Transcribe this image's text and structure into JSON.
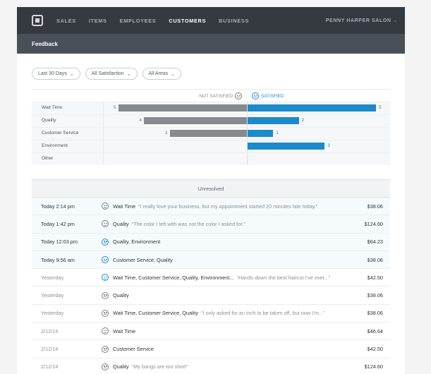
{
  "nav": {
    "items": [
      "SALES",
      "ITEMS",
      "EMPLOYEES",
      "CUSTOMERS",
      "BUSINESS"
    ],
    "active": "CUSTOMERS",
    "account": "PENNY HARPER SALON"
  },
  "subbar": {
    "title": "Feedback"
  },
  "filters": [
    {
      "label": "Last 30 Days"
    },
    {
      "label": "All Satisfaction"
    },
    {
      "label": "All Areas"
    }
  ],
  "chart_data": {
    "type": "bar",
    "header": {
      "negative": "NOT SATISFIED",
      "positive": "SATISFIED"
    },
    "categories": [
      "Wait Time",
      "Quality",
      "Customer Service",
      "Environment",
      "Other"
    ],
    "series": [
      {
        "name": "NOT SATISFIED",
        "values": [
          5,
          4,
          3,
          null,
          null
        ]
      },
      {
        "name": "SATISFIED",
        "values": [
          5,
          2,
          1,
          3,
          null
        ]
      }
    ],
    "colors": {
      "negative": "#86898e",
      "positive": "#1b8bcb"
    },
    "max": 5
  },
  "unresolved": {
    "label": "Unresolved"
  },
  "feedback": [
    {
      "date": "Today  2:14 pm",
      "categories": "Wait Time",
      "quote": "“I really love your business, but my appointment started 20 minutes late today.”",
      "amount": "$38.06",
      "satisfied": false,
      "unread": true
    },
    {
      "date": "Today  1:42 pm",
      "categories": "Quality",
      "quote": "“The color I left with was not the color I asked for.”",
      "amount": "$124.60",
      "satisfied": false,
      "unread": true
    },
    {
      "date": "Today  12:03 pm",
      "categories": "Quality, Environment",
      "quote": "",
      "amount": "$64.23",
      "satisfied": true,
      "unread": true
    },
    {
      "date": "Today  9:56 am",
      "categories": "Customer Service, Quality",
      "quote": "",
      "amount": "$38.06",
      "satisfied": true,
      "unread": true
    },
    {
      "date": "Yesterday",
      "categories": "Wait Time, Customer Service, Quality, Environment...",
      "quote": "“Hands down the best haircut I’ve ever...”",
      "amount": "$42.50",
      "satisfied": true,
      "unread": false
    },
    {
      "date": "Yesterday",
      "categories": "Quality",
      "quote": "",
      "amount": "$38.06",
      "satisfied": false,
      "unread": false
    },
    {
      "date": "Yesterday",
      "categories": "Wait Time, Customer Service, Quality",
      "quote": "“I only asked for an inch to be taken off, but now I’m...”",
      "amount": "$38.06",
      "satisfied": false,
      "unread": false
    },
    {
      "date": "2/12/14",
      "categories": "Wait Time",
      "quote": "",
      "amount": "$46.64",
      "satisfied": false,
      "unread": false
    },
    {
      "date": "2/12/14",
      "categories": "Customer Service",
      "quote": "",
      "amount": "$42.50",
      "satisfied": false,
      "unread": false
    },
    {
      "date": "2/12/14",
      "categories": "Quality",
      "quote": "“My bangs are too short”",
      "amount": "$124.60",
      "satisfied": false,
      "unread": false
    }
  ]
}
